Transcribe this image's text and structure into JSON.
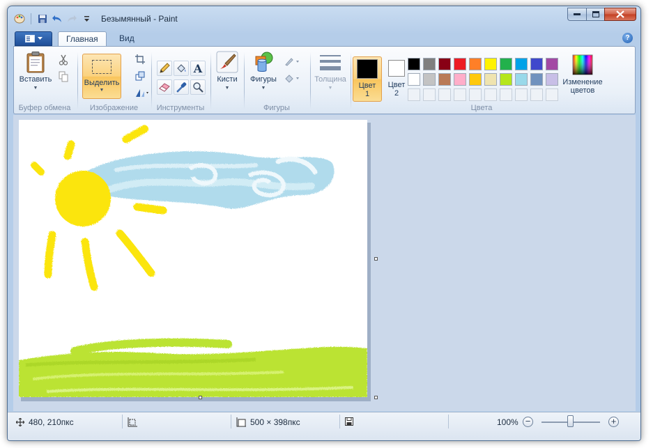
{
  "window": {
    "title": "Безымянный - Paint"
  },
  "tabs": [
    {
      "label": "Главная",
      "active": true
    },
    {
      "label": "Вид",
      "active": false
    }
  ],
  "groups": {
    "clipboard": {
      "label": "Буфер обмена",
      "paste": "Вставить"
    },
    "image": {
      "label": "Изображение",
      "select": "Выделить"
    },
    "tools": {
      "label": "Инструменты"
    },
    "brushes": {
      "label": "Кисти"
    },
    "shapes": {
      "label": "Фигуры",
      "button": "Фигуры"
    },
    "size": {
      "label": "Толщина"
    },
    "colors": {
      "label": "Цвета",
      "color1_line1": "Цвет",
      "color1_line2": "1",
      "color2_line1": "Цвет",
      "color2_line2": "2",
      "edit_line1": "Изменение",
      "edit_line2": "цветов",
      "color1": "#000000",
      "color2": "#ffffff",
      "palette_row1": [
        "#000000",
        "#7f7f7f",
        "#880015",
        "#ed1c24",
        "#ff7f27",
        "#fff200",
        "#22b14c",
        "#00a2e8",
        "#3f48cc",
        "#a349a4"
      ],
      "palette_row2": [
        "#ffffff",
        "#c3c3c3",
        "#b97a57",
        "#ffaec9",
        "#ffc90e",
        "#efe4b0",
        "#b5e61d",
        "#99d9ea",
        "#7092be",
        "#c8bfe7"
      ]
    }
  },
  "status": {
    "cursor_pos": "480, 210пкс",
    "image_size": "500 × 398пкс",
    "zoom": "100%"
  },
  "icons": {
    "app_menu": "paint-menu-icon",
    "save": "save-icon",
    "undo": "undo-icon",
    "redo": "redo-icon"
  }
}
